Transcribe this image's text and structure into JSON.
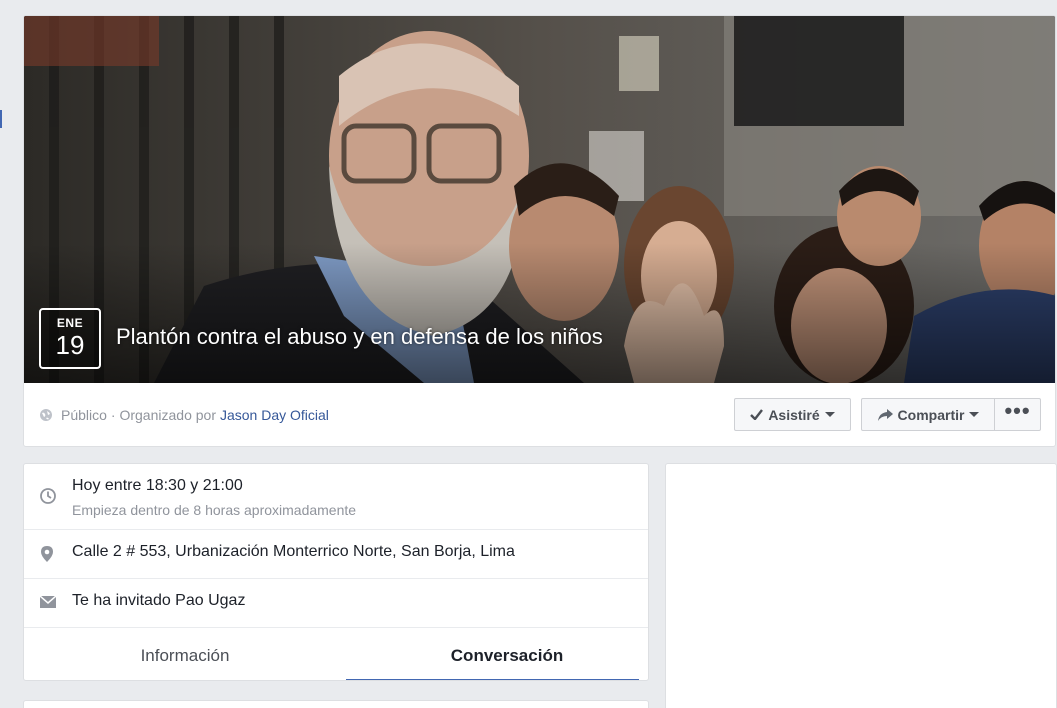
{
  "event": {
    "date_month": "ENE",
    "date_day": "19",
    "title": "Plantón contra el abuso y en defensa de los niños",
    "privacy_label": "Público",
    "organizer_prefix": "· Organizado por",
    "organizer_name": "Jason Day Oficial"
  },
  "actions": {
    "going_label": "Asistiré",
    "share_label": "Compartir",
    "more_label": "•••"
  },
  "details": {
    "time_main": "Hoy entre 18:30 y 21:00",
    "time_sub": "Empieza dentro de 8 horas aproximadamente",
    "location": "Calle 2 # 553, Urbanización Monterrico Norte, San Borja, Lima",
    "invitation": "Te ha invitado Pao Ugaz"
  },
  "tabs": {
    "info_label": "Información",
    "conversation_label": "Conversación",
    "active": "Conversación"
  },
  "icons": {
    "privacy": "globe-icon",
    "going": "check-icon",
    "share": "share-arrow-icon",
    "time": "clock-icon",
    "location": "map-pin-icon",
    "invite": "envelope-icon"
  },
  "colors": {
    "accent": "#4267b2",
    "link": "#365899",
    "muted": "#90949c",
    "background": "#e9ebee"
  }
}
